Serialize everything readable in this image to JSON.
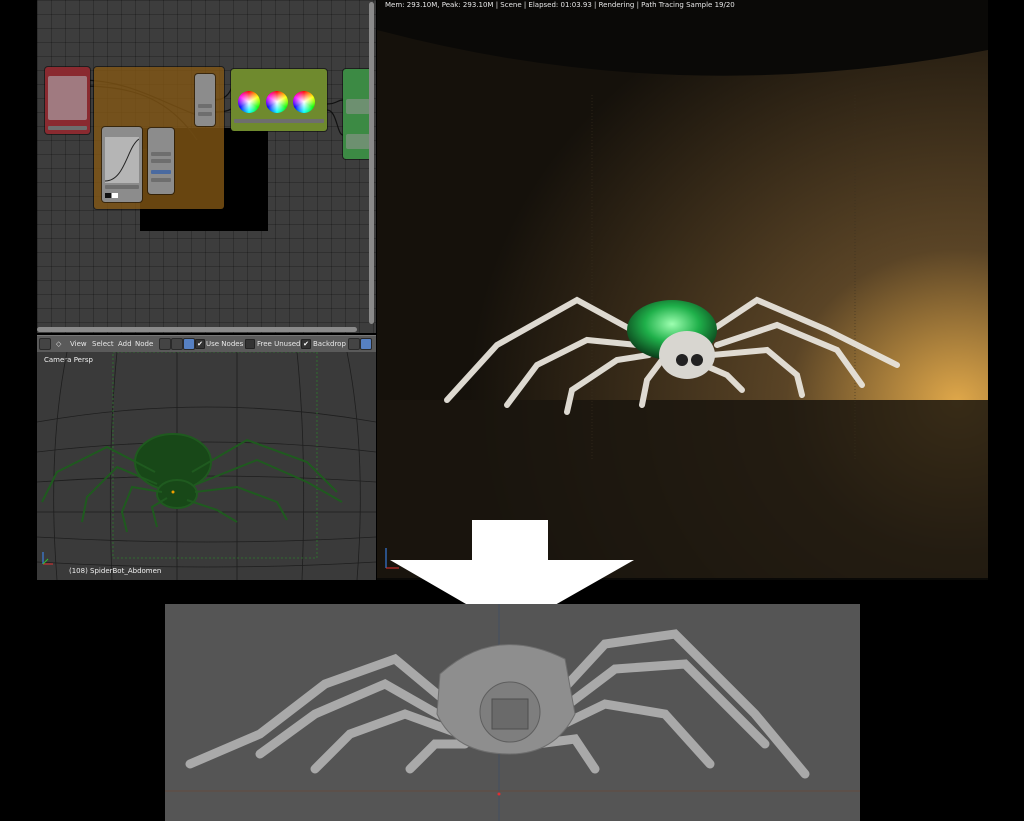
{
  "render_status": "Mem: 293.10M, Peak: 293.10M | Scene | Elapsed: 01:03.93 | Rendering | Path Tracing Sample 19/20",
  "node_editor": {
    "header": {
      "menu": [
        "View",
        "Select",
        "Add",
        "Node"
      ],
      "use_nodes_label": "Use Nodes",
      "use_nodes_checked": true,
      "free_unused_label": "Free Unused",
      "free_unused_checked": false,
      "backdrop_label": "Backdrop",
      "backdrop_checked": true
    },
    "node_colors": {
      "input": "#8a2a30",
      "frame": "#7a5215",
      "color_group": "#6f8a2e",
      "output": "#3c8a44"
    }
  },
  "viewport": {
    "view_label": "Camera Persp",
    "object_label": "(108) SpiderBot_Abdomen",
    "wire_color": "#1f5a1f"
  },
  "icons": {
    "down_arrow": "large-down-arrow",
    "checkbox": "check-mark"
  }
}
